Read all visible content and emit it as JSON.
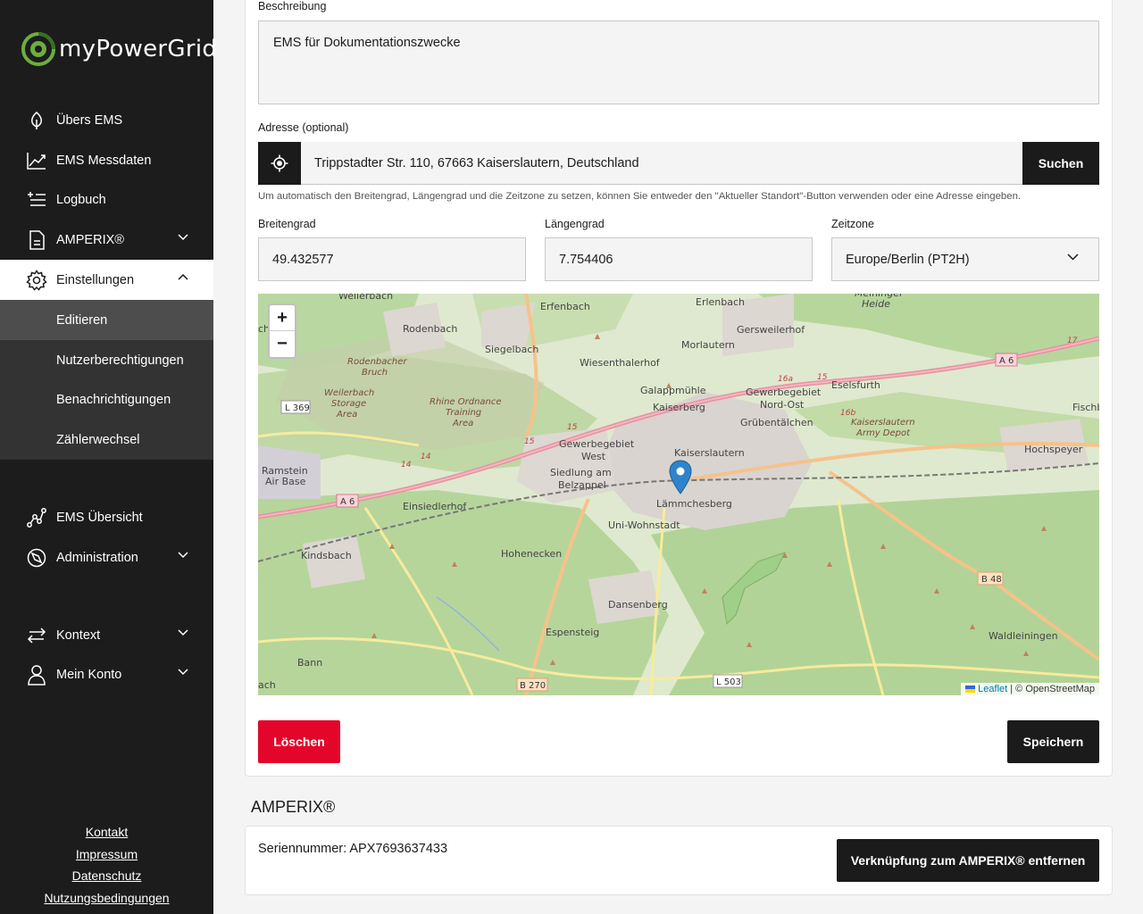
{
  "brand": {
    "name": "myPowerGrid"
  },
  "sidebar": {
    "items": [
      {
        "label": "Übers EMS",
        "icon": "leaf-icon"
      },
      {
        "label": "EMS Messdaten",
        "icon": "chart-line-icon"
      },
      {
        "label": "Logbuch",
        "icon": "list-add-icon"
      },
      {
        "label": "AMPERIX®",
        "icon": "document-icon"
      },
      {
        "label": "Einstellungen",
        "icon": "gear-icon"
      },
      {
        "label": "EMS Übersicht",
        "icon": "graph-nodes-icon"
      },
      {
        "label": "Administration",
        "icon": "compass-icon"
      },
      {
        "label": "Kontext",
        "icon": "swap-arrows-icon"
      },
      {
        "label": "Mein Konto",
        "icon": "user-icon"
      }
    ],
    "subitems": [
      {
        "label": "Editieren"
      },
      {
        "label": "Nutzerberechtigungen"
      },
      {
        "label": "Benachrichtigungen"
      },
      {
        "label": "Zählerwechsel"
      }
    ],
    "footer": [
      "Kontakt",
      "Impressum",
      "Datenschutz",
      "Nutzungsbedingungen"
    ]
  },
  "form": {
    "description_label": "Beschreibung",
    "description_value": "EMS für Dokumentationszwecke",
    "address_label": "Adresse (optional)",
    "address_value": "Trippstadter Str. 110, 67663 Kaiserslautern, Deutschland",
    "search_label": "Suchen",
    "help_text": "Um automatisch den Breitengrad, Längengrad und die Zeitzone zu setzen, können Sie entweder den \"Aktueller Standort\"-Button verwenden oder eine Adresse eingeben.",
    "lat_label": "Breitengrad",
    "lat_value": "49.432577",
    "lng_label": "Längengrad",
    "lng_value": "7.754406",
    "tz_label": "Zeitzone",
    "tz_value": "Europe/Berlin (PT2H)",
    "delete_label": "Löschen",
    "save_label": "Speichern"
  },
  "map": {
    "zoom_in": "+",
    "zoom_out": "−",
    "attribution_leaflet": "Leaflet",
    "attribution_rest": " | © OpenStreetMap",
    "places": [
      "Weilerbach",
      "Erfenbach",
      "Erlenbach",
      "Meininger Heide",
      "Rodenbach",
      "Siegelbach",
      "Gersweilerhof",
      "Morlautern",
      "Wiesenthalerhof",
      "Rodenbacher Bruch",
      "Weilerbach Storage Area",
      "Rhine Ordnance Training Area",
      "Galappmühle",
      "Kaiserberg",
      "Gewerbegebiet Nord-Ost",
      "Eselsfurth",
      "Grübentälchen",
      "Kaiserslautern Army Depot",
      "Gewerbegebiet West",
      "Kaiserslautern",
      "Siedlung am Belzappel",
      "Lämmchesberg",
      "Uni-Wohnstadt",
      "Einsiedlerhof",
      "Ramstein Air Base",
      "Kindsbach",
      "Hohenecken",
      "Dansenberg",
      "Espensteig",
      "Bann",
      "Hochspeyer",
      "Waldleiningen",
      "Fischb",
      "ach",
      "ch"
    ],
    "road_labels": [
      "L 369",
      "A 6",
      "A 6",
      "15",
      "15",
      "14",
      "14",
      "16a",
      "16b",
      "17",
      "15",
      "B 48",
      "B 270",
      "L 503"
    ],
    "marker": {
      "lat": 49.432577,
      "lng": 7.754406,
      "icon": "map-pin-icon"
    }
  },
  "amperix": {
    "title": "AMPERIX®",
    "serial_text": "Seriennummer: APX7693637433",
    "unlink_label": "Verknüpfung zum AMPERIX® entfernen"
  },
  "colors": {
    "accent": "#6cae3e",
    "danger": "#e3062a",
    "dark": "#1b1b1b"
  }
}
